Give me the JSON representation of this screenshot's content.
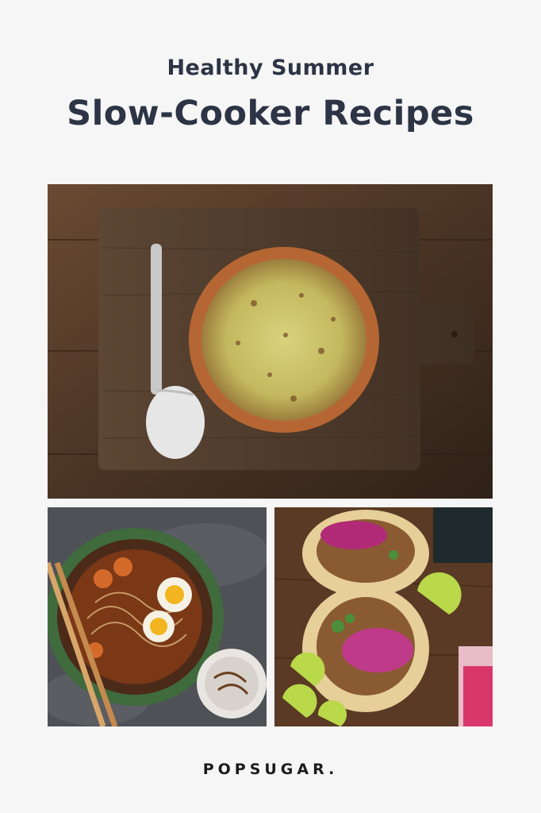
{
  "header": {
    "subtitle": "Healthy Summer",
    "title": "Slow-Cooker Recipes"
  },
  "images": [
    {
      "name": "casserole-on-cutting-board"
    },
    {
      "name": "ramen-bowl-with-egg"
    },
    {
      "name": "pulled-meat-tacos-with-lime"
    }
  ],
  "footer": {
    "brand": "POPSUGAR."
  },
  "colors": {
    "heading": "#2c3445",
    "background": "#f6f6f6",
    "brand": "#1c1c1c"
  }
}
